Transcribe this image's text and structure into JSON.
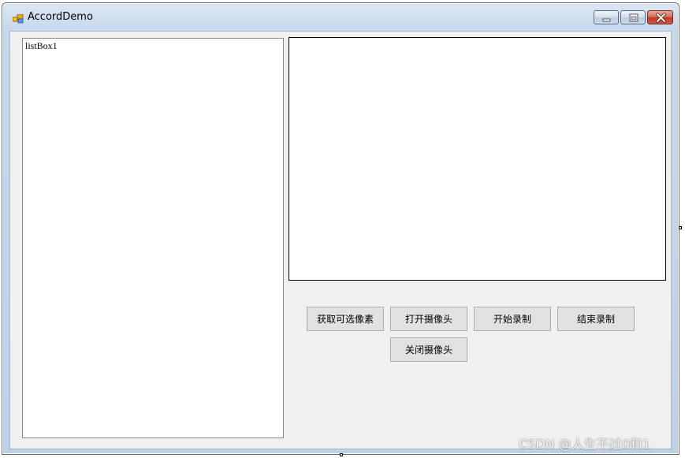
{
  "window": {
    "title": "AccordDemo",
    "controls": {
      "minimize": "minimize",
      "maximize": "maximize",
      "close": "close"
    }
  },
  "listbox": {
    "items": [
      "listBox1"
    ]
  },
  "buttons": {
    "get_pixels": "获取可选像素",
    "open_camera": "打开摄像头",
    "start_record": "开始录制",
    "stop_record": "结束录制",
    "close_camera": "关闭摄像头"
  },
  "watermark": "CSDN @人生不过0和1",
  "colors": {
    "client_background": "#f0f0f0",
    "button_face": "#e1e1e1",
    "close_button": "#c0392b"
  },
  "icons": {
    "app": "app-window-icon",
    "minimize": "minimize-icon",
    "maximize": "maximize-icon",
    "close": "close-icon"
  }
}
